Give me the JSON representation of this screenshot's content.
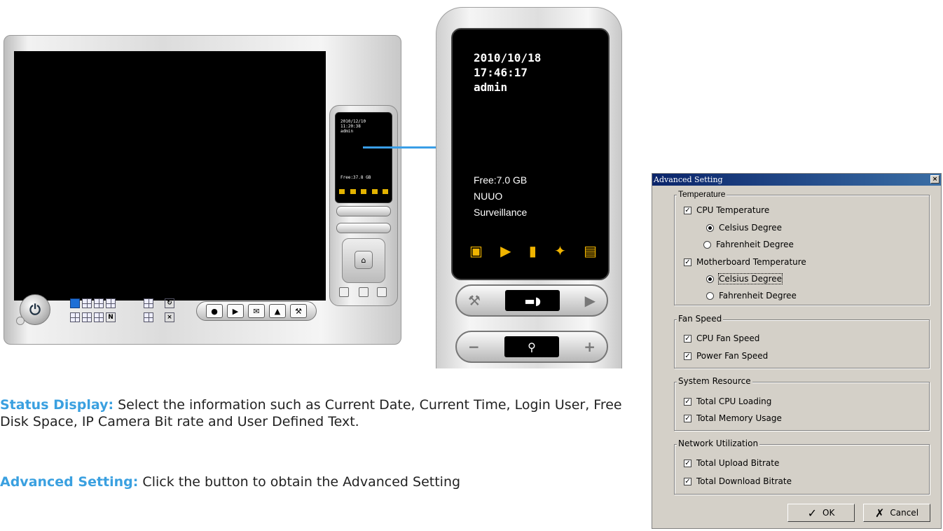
{
  "remote": {
    "date": "2010/10/18",
    "time": "17:46:17",
    "user": "admin",
    "free": "Free:7.0 GB",
    "line1": "NUUO",
    "line2": "Surveillance"
  },
  "mini": {
    "lines": "2010/12/10\n11:20:38\nadmin",
    "free": "Free:37.8 GB"
  },
  "desc": {
    "status_label": "Status Display:",
    "status_text": " Select the information such as Current Date, Current Time, Login User, Free Disk Space, IP Camera Bit rate and User Defined Text.",
    "advanced_label": "Advanced Setting:",
    "advanced_text": " Click the button to obtain the Advanced Setting"
  },
  "dialog": {
    "title": "Advanced Setting",
    "close": "×",
    "temperature": {
      "label": "Temperature",
      "cpu": "CPU Temperature",
      "cpu_celsius": "Celsius Degree",
      "cpu_fahrenheit": "Fahrenheit Degree",
      "mb": "Motherboard Temperature",
      "mb_celsius": "Celsius Degree",
      "mb_fahrenheit": "Fahrenheit Degree"
    },
    "fan": {
      "label": "Fan Speed",
      "cpu": "CPU Fan Speed",
      "power": "Power Fan Speed"
    },
    "system": {
      "label": "System Resource",
      "cpu": "Total CPU Loading",
      "mem": "Total Memory Usage"
    },
    "network": {
      "label": "Network Utilization",
      "up": "Total Upload Bitrate",
      "down": "Total Download Bitrate"
    },
    "ok": "OK",
    "cancel": "Cancel"
  }
}
